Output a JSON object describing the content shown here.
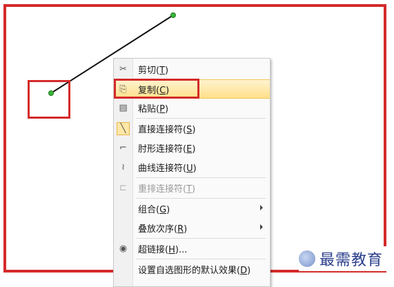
{
  "menu": {
    "items": [
      {
        "label": "剪切",
        "key": "T",
        "icon": "scissors-icon",
        "glyph": "✂",
        "enabled": true
      },
      {
        "label": "复制",
        "key": "C",
        "icon": "copy-icon",
        "glyph": "⎘",
        "enabled": true,
        "highlighted": true
      },
      {
        "label": "粘贴",
        "key": "P",
        "icon": "paste-icon",
        "glyph": "📋",
        "enabled": true
      },
      {
        "label": "直接连接符",
        "key": "S",
        "icon": "straight-connector-icon",
        "glyph": "╲",
        "enabled": true,
        "checked": true
      },
      {
        "label": "肘形连接符",
        "key": "E",
        "icon": "elbow-connector-icon",
        "glyph": "⌐",
        "enabled": true
      },
      {
        "label": "曲线连接符",
        "key": "U",
        "icon": "curved-connector-icon",
        "glyph": "≀",
        "enabled": true
      },
      {
        "label": "重排连接符",
        "key": "T",
        "icon": "reroute-connector-icon",
        "glyph": "⊏",
        "enabled": false
      },
      {
        "label": "组合",
        "key": "G",
        "icon": "",
        "glyph": "",
        "enabled": true,
        "submenu": true
      },
      {
        "label": "叠放次序",
        "key": "R",
        "icon": "",
        "glyph": "",
        "enabled": true,
        "submenu": true
      },
      {
        "label": "超链接",
        "key": "H",
        "suffix": "...",
        "icon": "hyperlink-icon",
        "glyph": "🌐",
        "enabled": true
      },
      {
        "label": "设置自选图形的默认效果",
        "key": "D",
        "icon": "",
        "glyph": "",
        "enabled": true
      }
    ]
  },
  "watermark": {
    "text": "最需教育"
  },
  "colors": {
    "annotation": "#d42a2a",
    "handle": "#3ab53a",
    "highlight": "#ffe08a"
  }
}
